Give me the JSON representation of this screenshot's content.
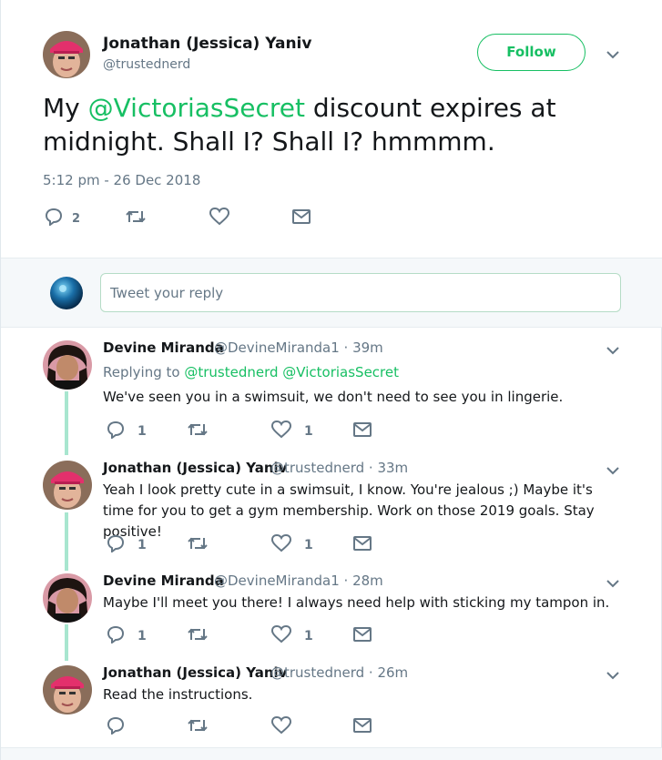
{
  "main_tweet": {
    "author_name": "Jonathan (Jessica) Yaniv",
    "author_handle": "@trustednerd",
    "follow_label": "Follow",
    "text_prefix": "My ",
    "text_mention": "@VictoriasSecret",
    "text_line1_rest": " discount expires at",
    "text_line2": "midnight. Shall I? Shall I? hmmmm.",
    "timestamp": "5:12 pm - 26 Dec 2018",
    "reply_count": "2",
    "accent_color": "#17bf63"
  },
  "composer": {
    "placeholder": "Tweet your reply"
  },
  "replies": [
    {
      "name": "Devine Miranda",
      "meta": "@DevineMiranda1 · 39m",
      "replying_label": "Replying to ",
      "replying_to_1": "@trustednerd",
      "replying_to_2": "@VictoriasSecret",
      "text": "We've seen you in a swimsuit, we don't need to see you in lingerie.",
      "reply_count": "1",
      "like_count": "1"
    },
    {
      "name": "Jonathan (Jessica) Yaniv",
      "meta": "@trustednerd · 33m",
      "text": "Yeah I look pretty cute in a swimsuit, I know. You're jealous ;) Maybe it's time for you to get a gym membership. Work on those 2019 goals. Stay positive!",
      "reply_count": "1",
      "like_count": "1"
    },
    {
      "name": "Devine Miranda",
      "meta": "@DevineMiranda1 · 28m",
      "text": "Maybe I'll meet you there! I always need help with sticking my tampon in.",
      "reply_count": "1",
      "like_count": "1"
    },
    {
      "name": "Jonathan (Jessica) Yaniv",
      "meta": "@trustednerd · 26m",
      "text": "Read the instructions."
    }
  ],
  "icons": {
    "reply": "reply-icon",
    "retweet": "retweet-icon",
    "like": "heart-icon",
    "dm": "envelope-icon",
    "more": "chevron-down-icon"
  }
}
